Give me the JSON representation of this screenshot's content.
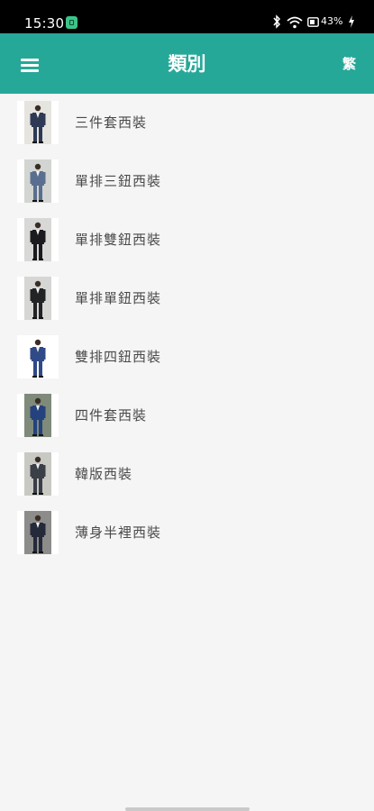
{
  "status_bar": {
    "time": "15:30",
    "battery_percent": "43%",
    "icons": [
      "app-notification-icon",
      "bluetooth-icon",
      "wifi-icon",
      "battery-saver-icon",
      "charging-icon"
    ]
  },
  "app_bar": {
    "title": "類別",
    "language_toggle": "繁",
    "menu_icon": "hamburger-menu-icon",
    "color": "#26a899"
  },
  "categories": [
    {
      "label": "三件套西裝",
      "suit_color": "#2e3a55",
      "bg": "#e6e4df"
    },
    {
      "label": "單排三鈕西裝",
      "suit_color": "#5a6f8f",
      "bg": "#d3d5d2"
    },
    {
      "label": "單排雙鈕西裝",
      "suit_color": "#1b1b1f",
      "bg": "#d8d8d6"
    },
    {
      "label": "單排單鈕西裝",
      "suit_color": "#222325",
      "bg": "#d6d6d4"
    },
    {
      "label": "雙排四鈕西裝",
      "suit_color": "#2f4a86",
      "bg": "#ffffff"
    },
    {
      "label": "四件套西裝",
      "suit_color": "#24427e",
      "bg": "#7f8a7a"
    },
    {
      "label": "韓版西裝",
      "suit_color": "#3a3f48",
      "bg": "#c9c9c4"
    },
    {
      "label": "薄身半裡西裝",
      "suit_color": "#242a3a",
      "bg": "#8c8c8a"
    }
  ]
}
